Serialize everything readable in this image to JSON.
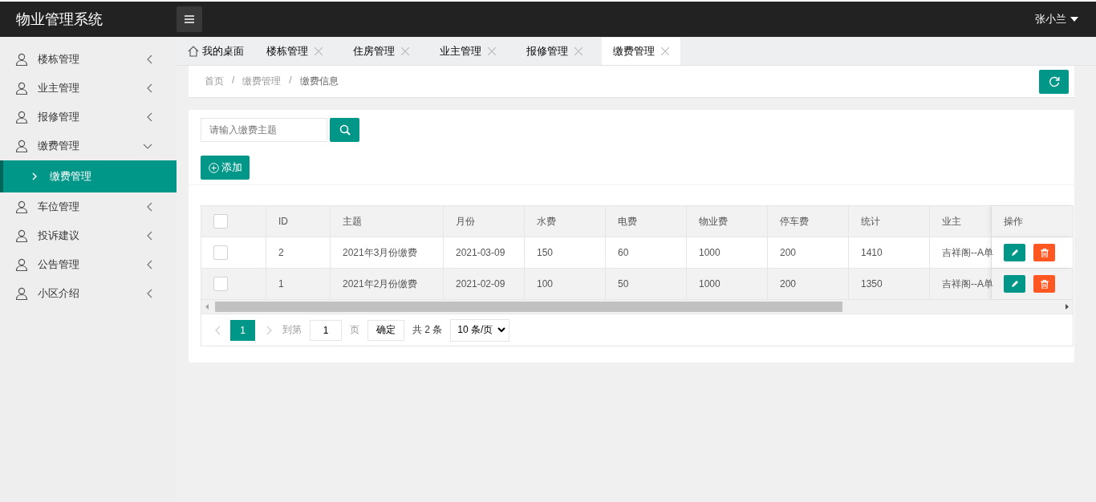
{
  "header": {
    "title": "物业管理系统",
    "user": "张小兰"
  },
  "sidebar": {
    "items": [
      {
        "label": "楼栋管理",
        "expanded": false
      },
      {
        "label": "业主管理",
        "expanded": false
      },
      {
        "label": "报修管理",
        "expanded": false
      },
      {
        "label": "缴费管理",
        "expanded": true,
        "children": [
          {
            "label": "缴费管理",
            "selected": true
          }
        ]
      },
      {
        "label": "车位管理",
        "expanded": false
      },
      {
        "label": "投诉建议",
        "expanded": false
      },
      {
        "label": "公告管理",
        "expanded": false
      },
      {
        "label": "小区介绍",
        "expanded": false
      }
    ]
  },
  "tabs": [
    {
      "label": "我的桌面",
      "kind": "home",
      "selected": false
    },
    {
      "label": "楼栋管理",
      "kind": "closable",
      "selected": false
    },
    {
      "label": "住房管理",
      "kind": "closable",
      "selected": false
    },
    {
      "label": "业主管理",
      "kind": "closable",
      "selected": false
    },
    {
      "label": "报修管理",
      "kind": "closable",
      "selected": false
    },
    {
      "label": "缴费管理",
      "kind": "closable",
      "selected": true
    }
  ],
  "breadcrumb": [
    {
      "label": "首页",
      "separator": "/"
    },
    {
      "label": "缴费管理",
      "separator": "/"
    },
    {
      "label": "缴费信息"
    }
  ],
  "search": {
    "placeholder": "请输入缴费主题"
  },
  "add_button": "添加",
  "table": {
    "all_checked": false,
    "columns": [
      "ID",
      "主题",
      "月份",
      "水费",
      "电费",
      "物业费",
      "停车费",
      "统计",
      "业主",
      "操作"
    ],
    "rows": [
      {
        "checked": false,
        "cells": [
          "2",
          "2021年3月份缴费",
          "2021-03-09",
          "150",
          "60",
          "1000",
          "200",
          "1410",
          "吉祥阁--A单"
        ]
      },
      {
        "checked": false,
        "cells": [
          "1",
          "2021年2月份缴费",
          "2021-02-09",
          "100",
          "50",
          "1000",
          "200",
          "1350",
          "吉祥阁--A单"
        ]
      }
    ]
  },
  "pager": {
    "pages": [
      {
        "label": "1",
        "selected": true
      }
    ],
    "goto_label": "到第",
    "goto_value": "1",
    "page_unit": "页",
    "confirm": "确定",
    "total": "共 2 条",
    "page_size": "10 条/页"
  }
}
